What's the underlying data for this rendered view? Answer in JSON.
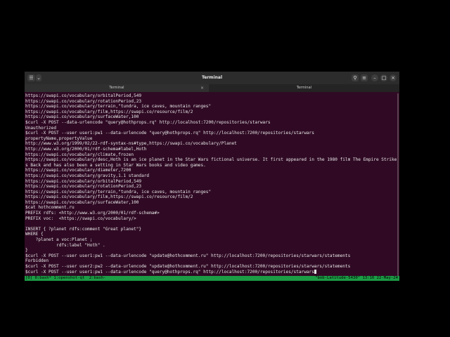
{
  "window": {
    "title": "Terminal",
    "menu_icon": "hamburger-icon",
    "dropdown_icon": "chevron-down-icon",
    "search_icon": "search-icon",
    "menu_icon_right": "menu-icon",
    "minimize_icon": "minimize-icon",
    "maximize_icon": "maximize-icon",
    "close_icon": "close-icon"
  },
  "tabs": [
    {
      "label": "Terminal",
      "active": true
    },
    {
      "label": "Terminal",
      "active": false
    }
  ],
  "terminal": {
    "lines": [
      "https://swapi.co/vocabulary/orbitalPeriod,549",
      "https://swapi.co/vocabulary/rotationPeriod,23",
      "https://swapi.co/vocabulary/terrain,\"tundra, ice caves, mountain ranges\"",
      "https://swapi.co/vocabulary/film,https://swapi.co/resource/film/2",
      "https://swapi.co/vocabulary/surfaceWater,100",
      "$curl -X POST --data-urlencode \"query@hothprops.rq\" http://localhost:7200/repositories/starwars",
      "Unauthorized",
      "$curl -X POST --user user1:pw1 --data-urlencode \"query@hothprops.rq\" http://localhost:7200/repositories/starwars",
      "propertyName,propertyValue",
      "http://www.w3.org/1999/02/22-rdf-syntax-ns#type,https://swapi.co/vocabulary/Planet",
      "http://www.w3.org/2000/01/rdf-schema#label,Hoth",
      "https://swapi.co/vocabulary/climate,frozen",
      "https://swapi.co/vocabulary/desc,Hoth is an ice planet in the Star Wars fictional universe. It first appeared in the 1980 film The Empire Strike",
      "s Back and has also been a setting in Star Wars books and video games.",
      "https://swapi.co/vocabulary/diameter,7200",
      "https://swapi.co/vocabulary/gravity,1.1 standard",
      "https://swapi.co/vocabulary/orbitalPeriod,549",
      "https://swapi.co/vocabulary/rotationPeriod,23",
      "https://swapi.co/vocabulary/terrain,\"tundra, ice caves, mountain ranges\"",
      "https://swapi.co/vocabulary/film,https://swapi.co/resource/film/2",
      "https://swapi.co/vocabulary/surfaceWater,100",
      "$cat hothcomment.ru",
      "PREFIX rdfs: <http://www.w3.org/2000/01/rdf-schema#>",
      "PREFIX voc:  <https://swapi.co/vocabulary/>",
      "",
      "INSERT { ?planet rdfs:comment \"Great planet\"}",
      "WHERE {",
      "    ?planet a voc:Planet ;",
      "            rdfs:label \"Hoth\" .",
      "}",
      "$curl -X POST --user user1:pw1 --data-urlencode \"update@hothcomment.ru\" http://localhost:7200/repositories/starwars/statements",
      "Forbidden",
      "$curl -X POST --user user2:pw2 --data-urlencode \"update@hothcomment.ru\" http://localhost:7200/repositories/starwars/statements",
      "$curl -X POST --user user1:pw1 --data-urlencode \"query@hothprops.rq\" http://localhost:7200/repositories/starwars"
    ]
  },
  "tmux": {
    "left": "[0] 0:bash* 1:openshot-qt  2:bash-",
    "right": "\"bob-Latitude-5430\" 13:16 22-May-24"
  },
  "colors": {
    "terminal_bg": "#300a24",
    "status_bar": "#1c9b45",
    "titlebar": "#2c2c2c"
  }
}
